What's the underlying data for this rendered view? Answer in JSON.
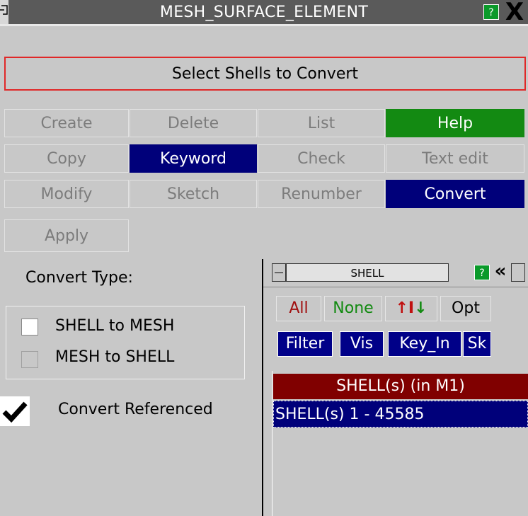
{
  "window": {
    "title": "MESH_SURFACE_ELEMENT",
    "help_glyph": "?",
    "close_glyph": "X"
  },
  "prompt": "Select Shells to Convert",
  "buttons": {
    "create": "Create",
    "delete": "Delete",
    "list": "List",
    "help": "Help",
    "copy": "Copy",
    "keyword": "Keyword",
    "check": "Check",
    "text_edit": "Text edit",
    "modify": "Modify",
    "sketch": "Sketch",
    "renumber": "Renumber",
    "convert": "Convert",
    "apply": "Apply"
  },
  "convert_type": {
    "label": "Convert Type:",
    "options": [
      "SHELL to MESH",
      "MESH to SHELL"
    ]
  },
  "convert_referenced": {
    "label": "Convert Referenced",
    "checked": true
  },
  "shell_panel": {
    "title": "SHELL",
    "help_glyph": "?",
    "collapse_glyph": "«",
    "buttons": {
      "all": "All",
      "none": "None",
      "updown": "↑I↓",
      "opt": "Opt",
      "filter": "Filter",
      "vis": "Vis",
      "key_in": "Key_In",
      "sk": "Sk"
    },
    "list_header": "SHELL(s) (in M1)",
    "list_items": [
      "SHELL(s) 1 - 45585"
    ]
  },
  "colors": {
    "accent_blue": "#00007a",
    "help_green": "#138a12",
    "list_header_red": "#800000",
    "prompt_border_red": "#e02828"
  }
}
